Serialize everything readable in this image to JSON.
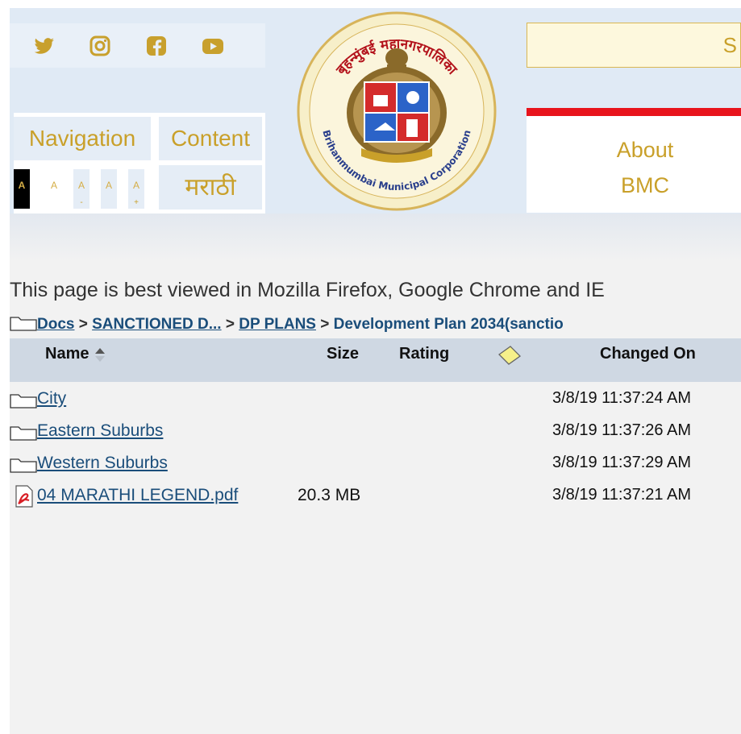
{
  "header": {
    "social_icons": [
      "twitter-icon",
      "instagram-icon",
      "facebook-icon",
      "youtube-icon"
    ],
    "nav_label": "Navigation",
    "content_label": "Content",
    "font_sizes": [
      {
        "label": "A",
        "sub": ""
      },
      {
        "label": "A",
        "sub": ""
      },
      {
        "label": "A",
        "sub": "-"
      },
      {
        "label": "A",
        "sub": ""
      },
      {
        "label": "A",
        "sub": "+"
      }
    ],
    "language": "मराठी",
    "logo": {
      "top_text": "बृहन्मुंबई महानगरपालिका",
      "bottom_text": "Brihanmumbai Municipal Corporation"
    },
    "search_text": "S",
    "menu": {
      "about_line1": "About",
      "about_line2": "BMC"
    }
  },
  "notice": "This page is best viewed in Mozilla Firefox, Google Chrome and IE",
  "breadcrumb": {
    "items": [
      "Docs",
      "SANCTIONED D...",
      "DP PLANS"
    ],
    "current": "Development Plan 2034(sanctio"
  },
  "table": {
    "columns": {
      "name": "Name",
      "size": "Size",
      "rating": "Rating",
      "changed": "Changed On"
    },
    "rows": [
      {
        "type": "folder",
        "name": "City",
        "size": "",
        "changed": "3/8/19 11:37:24 AM"
      },
      {
        "type": "folder",
        "name": "Eastern Suburbs",
        "size": "",
        "changed": "3/8/19 11:37:26 AM"
      },
      {
        "type": "folder",
        "name": "Western Suburbs",
        "size": "",
        "changed": "3/8/19 11:37:29 AM"
      },
      {
        "type": "pdf",
        "name": "04 MARATHI LEGEND.pdf",
        "size": "20.3 MB",
        "changed": "3/8/19 11:37:21 AM"
      }
    ]
  },
  "colors": {
    "gold": "#c9a02a",
    "header_bg": "#e0eaf5",
    "red_bar": "#e8141c",
    "link": "#1a4d7a"
  }
}
